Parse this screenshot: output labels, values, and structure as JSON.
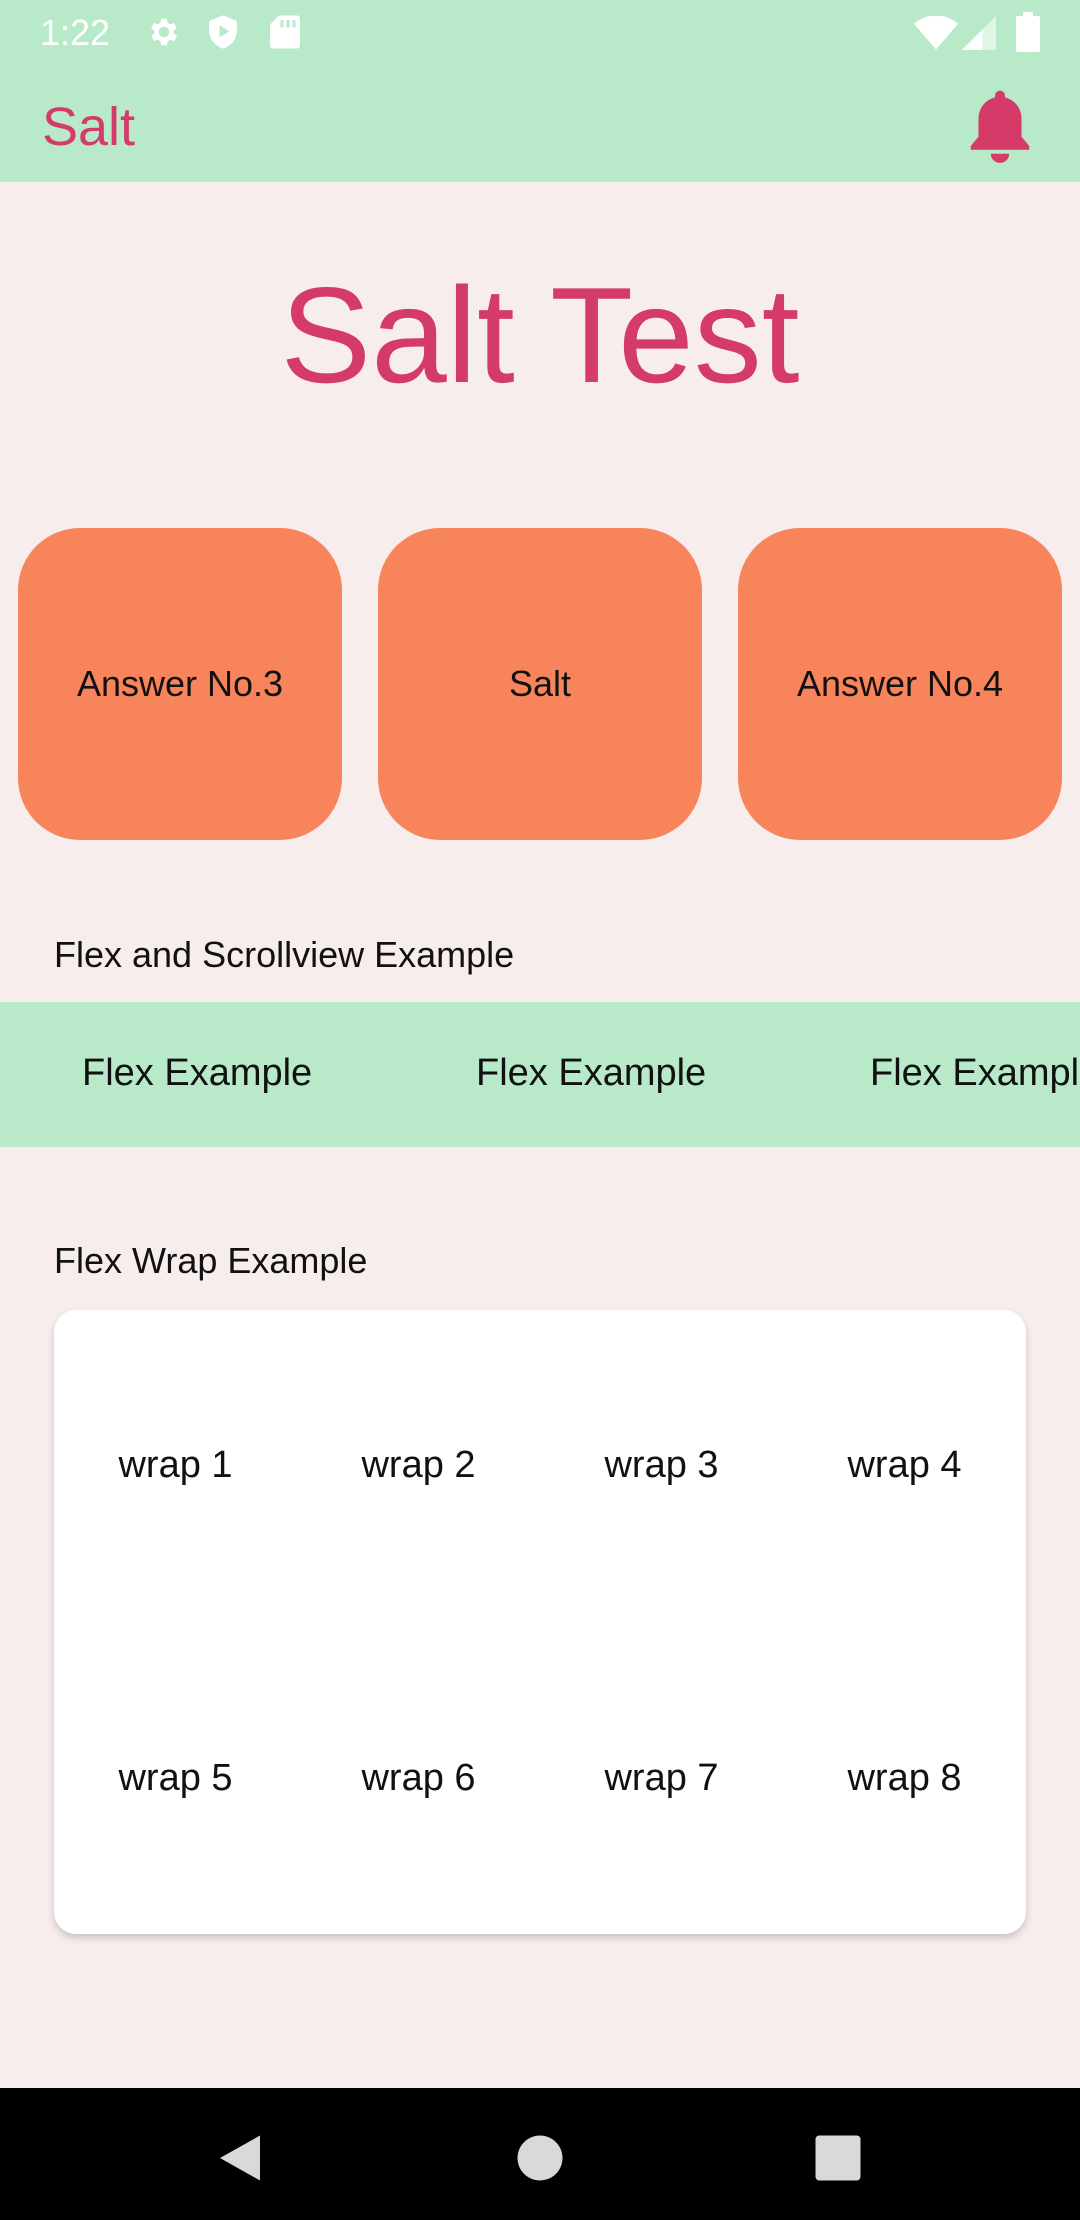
{
  "status_bar": {
    "time": "1:22",
    "left_icons": [
      "gear-icon",
      "shield-play-icon",
      "sd-card-icon"
    ],
    "right_icons": [
      "wifi-icon",
      "signal-icon",
      "battery-icon"
    ]
  },
  "app_bar": {
    "title": "Salt",
    "action_icon": "bell-icon",
    "background": "#b8eaca",
    "accent": "#d43b68"
  },
  "main": {
    "title": "Salt Test",
    "answer_cards": [
      {
        "label": "Answer No.3"
      },
      {
        "label": "Salt"
      },
      {
        "label": "Answer No.4"
      }
    ],
    "card_color": "#f7845b",
    "flex_section": {
      "label": "Flex and Scrollview Example",
      "items": [
        "Flex Example",
        "Flex Example",
        "Flex Example"
      ]
    },
    "wrap_section": {
      "label": "Flex Wrap Example",
      "items": [
        "wrap 1",
        "wrap 2",
        "wrap 3",
        "wrap 4",
        "wrap 5",
        "wrap 6",
        "wrap 7",
        "wrap 8"
      ]
    }
  },
  "nav_bar": {
    "buttons": [
      "back-icon",
      "home-icon",
      "recents-icon"
    ]
  }
}
